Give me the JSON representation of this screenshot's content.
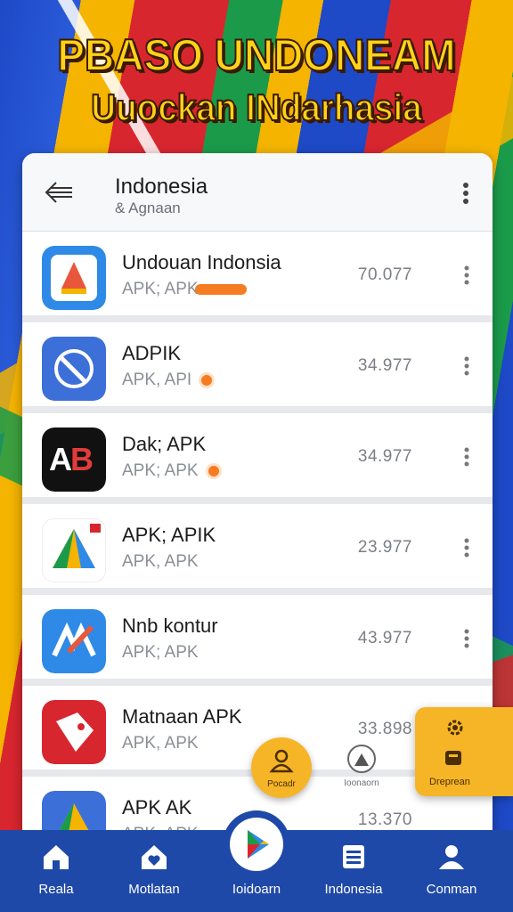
{
  "banner": {
    "line1": "PBASO UNDONEAM",
    "line2": "Uuockan INdarhasia"
  },
  "header": {
    "title": "Indonesia",
    "subtitle": "& Agnaan"
  },
  "apps": [
    {
      "name": "Undouan Indonsia",
      "sub": "APK; APK",
      "count": "70.077",
      "icon": "shield-book-icon"
    },
    {
      "name": "ADPIK",
      "sub": "APK, API",
      "count": "34.977",
      "icon": "compass-icon"
    },
    {
      "name": "Dak; APK",
      "sub": "APK; APK",
      "count": "34.977",
      "icon": "ab-logo-icon"
    },
    {
      "name": "APK; APIK",
      "sub": "APK, APK",
      "count": "23.977",
      "icon": "drive-triangle-icon"
    },
    {
      "name": "Nnb kontur",
      "sub": "APK; APK",
      "count": "43.977",
      "icon": "m-logo-icon"
    },
    {
      "name": "Matnaan APK",
      "sub": "APK, APK",
      "count": "33.898",
      "icon": "fox-icon"
    },
    {
      "name": "APK AK",
      "sub": "APK. APK",
      "count": "13.370",
      "icon": "drive-triangle-icon"
    }
  ],
  "fabs": {
    "primary_label": "Pocadr",
    "secondary_label": "Ioonaorn",
    "side_label": "Dreprean"
  },
  "bottom_nav": [
    {
      "label": "Reala",
      "icon": "home-icon"
    },
    {
      "label": "Motlatan",
      "icon": "home-heart-icon"
    },
    {
      "label": "Ioidoarn",
      "icon": "play-store-icon"
    },
    {
      "label": "Indonesia",
      "icon": "list-icon"
    },
    {
      "label": "Conman",
      "icon": "person-icon"
    }
  ],
  "colors": {
    "accent_blue": "#1f49a8",
    "accent_yellow": "#f6b527",
    "accent_orange": "#f57c23",
    "banner_text": "#ffd21a"
  }
}
